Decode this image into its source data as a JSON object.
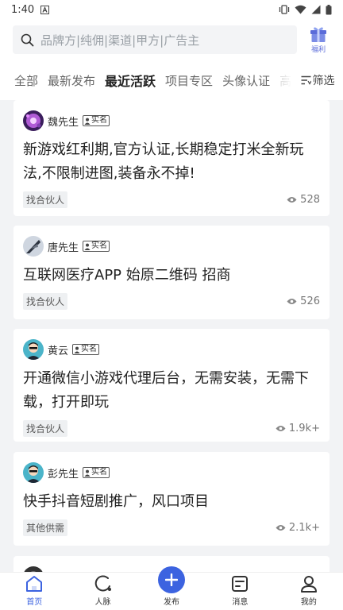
{
  "status_bar": {
    "time": "1:40"
  },
  "search": {
    "placeholder": "品牌方|纯佣|渠道|甲方|广告主"
  },
  "gift": {
    "label": "福利"
  },
  "tabs": [
    {
      "label": "全部"
    },
    {
      "label": "最新发布"
    },
    {
      "label": "最近活跃"
    },
    {
      "label": "项目专区"
    },
    {
      "label": "头像认证"
    },
    {
      "label": "高"
    }
  ],
  "filter_label": "筛选",
  "posts": [
    {
      "name": "魏先生",
      "verified": "实名",
      "title": "新游戏红利期,官方认证,长期稳定打米全新玩法,不限制进图,装备永不掉!",
      "tag": "找合伙人",
      "views": "528"
    },
    {
      "name": "唐先生",
      "verified": "实名",
      "title": "互联网医疗APP 始原二维码 招商",
      "tag": "找合伙人",
      "views": "526"
    },
    {
      "name": "黄云",
      "verified": "实名",
      "title": "开通微信小游戏代理后台，无需安装，无需下载，打开即玩",
      "tag": "找合伙人",
      "views": "1.9k+"
    },
    {
      "name": "彭先生",
      "verified": "实名",
      "title": "快手抖音短剧推广，风口项目",
      "tag": "其他供需",
      "views": "2.1k+"
    }
  ],
  "nav": [
    {
      "label": "首页"
    },
    {
      "label": "人脉"
    },
    {
      "label": "发布"
    },
    {
      "label": "消息"
    },
    {
      "label": "我的"
    }
  ],
  "colors": {
    "accent": "#3c63e0",
    "page_bg": "#f2f3f5",
    "gift_purple": "#5a6bd9"
  }
}
